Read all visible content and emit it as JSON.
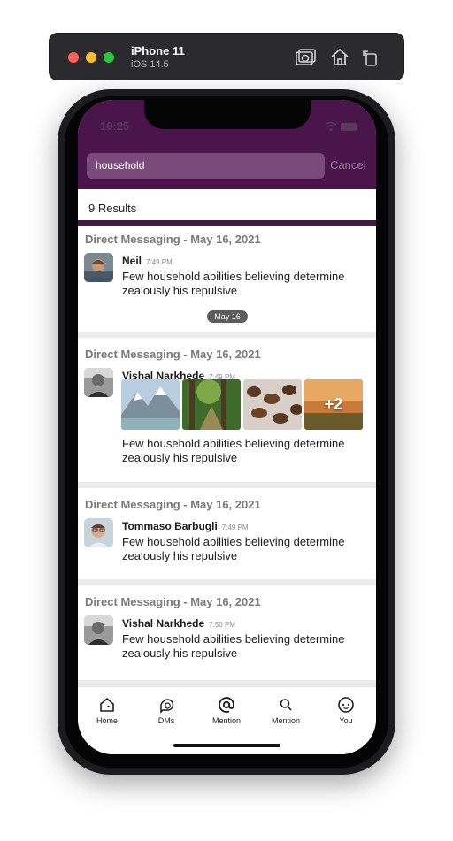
{
  "simulator": {
    "device": "iPhone 11",
    "os": "iOS 14.5",
    "icons": [
      "screenshot-icon",
      "home-icon",
      "rotate-icon"
    ]
  },
  "status": {
    "time": "10:25"
  },
  "search": {
    "query": "household",
    "cancel_label": "Cancel"
  },
  "results": {
    "count_label": "9 Results",
    "items": [
      {
        "context": "Direct Messaging - May 16, 2021",
        "user": "Neil",
        "time": "7:49 PM",
        "text": "Few household abilities believing determine zealously his repulsive",
        "date_pill": "May 16"
      },
      {
        "context": "Direct Messaging - May 16, 2021",
        "user": "Vishal Narkhede",
        "time": "7:49 PM",
        "text": "Few household abilities believing determine zealously his repulsive",
        "attachments_more": "+2"
      },
      {
        "context": "Direct Messaging - May 16, 2021",
        "user": "Tommaso Barbugli",
        "time": "7:49 PM",
        "text": "Few household abilities believing determine zealously his repulsive"
      },
      {
        "context": "Direct Messaging - May 16, 2021",
        "user": "Vishal Narkhede",
        "time": "7:50 PM",
        "text": "Few household abilities believing determine zealously his repulsive"
      }
    ]
  },
  "tabs": [
    {
      "label": "Home",
      "icon": "home-icon"
    },
    {
      "label": "DMs",
      "icon": "dms-icon"
    },
    {
      "label": "Mention",
      "icon": "at-icon"
    },
    {
      "label": "Mention",
      "icon": "search-icon"
    },
    {
      "label": "You",
      "icon": "you-icon"
    }
  ],
  "colors": {
    "header": "#4a154b",
    "search_field": "#7a4a7b",
    "cancel": "#9b7a9b",
    "separator": "#ececec"
  }
}
